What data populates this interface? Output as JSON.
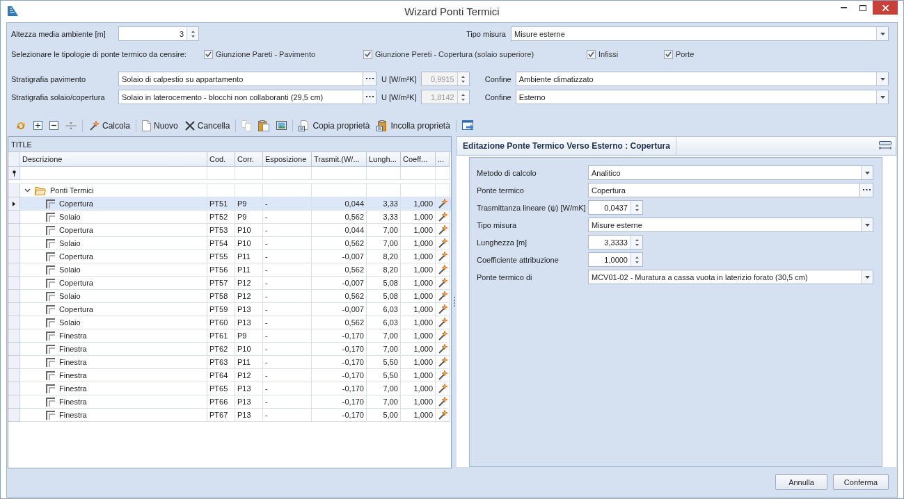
{
  "window": {
    "title": "Wizard Ponti Termici"
  },
  "form": {
    "height": {
      "label": "Altezza media ambiente [m]",
      "value": "3"
    },
    "measure": {
      "label": "Tipo misura",
      "value": "Misure esterne"
    },
    "prompt": "Selezionare le tipologie di ponte termico da censire:",
    "bridge_types": [
      {
        "label": "Giunzione Pareti - Pavimento",
        "checked": true
      },
      {
        "label": "Giunzione Pereti - Copertura (solaio superiore)",
        "checked": true
      },
      {
        "label": "Infissi",
        "checked": true
      },
      {
        "label": "Porte",
        "checked": true
      }
    ],
    "layers": [
      {
        "label": "Stratigrafia pavimento",
        "value": "Solaio di calpestio su appartamento",
        "u_label": "U [W/m²K]",
        "u_value": "0,9915",
        "u_disabled": true,
        "boundary_label": "Confine",
        "boundary_value": "Ambiente climatizzato"
      },
      {
        "label": "Stratigrafia solaio/copertura",
        "value": "Solaio in laterocemento - blocchi non collaboranti (29,5 cm)",
        "u_label": "U [W/m²K]",
        "u_value": "1,8142",
        "u_disabled": true,
        "boundary_label": "Confine",
        "boundary_value": "Esterno"
      }
    ]
  },
  "toolbar": {
    "buttons": [
      "Calcola",
      "Nuovo",
      "Cancella",
      "Copia proprietà",
      "Incolla proprietà"
    ]
  },
  "grid": {
    "title": "TITLE",
    "columns": [
      "Descrizione",
      "Cod.",
      "Corr.",
      "Esposizione",
      "Trasmit.(W/...",
      "Lungh...",
      "Coeff...",
      "..."
    ],
    "group": {
      "label": "Ponti Termici",
      "expanded": true
    },
    "rows": [
      {
        "descrizione": "Copertura",
        "cod": "PT51",
        "corr": "P9",
        "esposizione": "-",
        "trasmit": "0,044",
        "lungh": "3,33",
        "coeff": "1,000",
        "selected": true
      },
      {
        "descrizione": "Solaio",
        "cod": "PT52",
        "corr": "P9",
        "esposizione": "-",
        "trasmit": "0,562",
        "lungh": "3,33",
        "coeff": "1,000",
        "selected": false
      },
      {
        "descrizione": "Copertura",
        "cod": "PT53",
        "corr": "P10",
        "esposizione": "-",
        "trasmit": "0,044",
        "lungh": "7,00",
        "coeff": "1,000",
        "selected": false
      },
      {
        "descrizione": "Solaio",
        "cod": "PT54",
        "corr": "P10",
        "esposizione": "-",
        "trasmit": "0,562",
        "lungh": "7,00",
        "coeff": "1,000",
        "selected": false
      },
      {
        "descrizione": "Copertura",
        "cod": "PT55",
        "corr": "P11",
        "esposizione": "-",
        "trasmit": "-0,007",
        "lungh": "8,20",
        "coeff": "1,000",
        "selected": false
      },
      {
        "descrizione": "Solaio",
        "cod": "PT56",
        "corr": "P11",
        "esposizione": "-",
        "trasmit": "0,562",
        "lungh": "8,20",
        "coeff": "1,000",
        "selected": false
      },
      {
        "descrizione": "Copertura",
        "cod": "PT57",
        "corr": "P12",
        "esposizione": "-",
        "trasmit": "-0,007",
        "lungh": "5,08",
        "coeff": "1,000",
        "selected": false
      },
      {
        "descrizione": "Solaio",
        "cod": "PT58",
        "corr": "P12",
        "esposizione": "-",
        "trasmit": "0,562",
        "lungh": "5,08",
        "coeff": "1,000",
        "selected": false
      },
      {
        "descrizione": "Copertura",
        "cod": "PT59",
        "corr": "P13",
        "esposizione": "-",
        "trasmit": "-0,007",
        "lungh": "6,03",
        "coeff": "1,000",
        "selected": false
      },
      {
        "descrizione": "Solaio",
        "cod": "PT60",
        "corr": "P13",
        "esposizione": "-",
        "trasmit": "0,562",
        "lungh": "6,03",
        "coeff": "1,000",
        "selected": false
      },
      {
        "descrizione": "Finestra",
        "cod": "PT61",
        "corr": "P9",
        "esposizione": "-",
        "trasmit": "-0,170",
        "lungh": "7,00",
        "coeff": "1,000",
        "selected": false
      },
      {
        "descrizione": "Finestra",
        "cod": "PT62",
        "corr": "P10",
        "esposizione": "-",
        "trasmit": "-0,170",
        "lungh": "7,00",
        "coeff": "1,000",
        "selected": false
      },
      {
        "descrizione": "Finestra",
        "cod": "PT63",
        "corr": "P11",
        "esposizione": "-",
        "trasmit": "-0,170",
        "lungh": "5,50",
        "coeff": "1,000",
        "selected": false
      },
      {
        "descrizione": "Finestra",
        "cod": "PT64",
        "corr": "P12",
        "esposizione": "-",
        "trasmit": "-0,170",
        "lungh": "5,50",
        "coeff": "1,000",
        "selected": false
      },
      {
        "descrizione": "Finestra",
        "cod": "PT65",
        "corr": "P13",
        "esposizione": "-",
        "trasmit": "-0,170",
        "lungh": "7,00",
        "coeff": "1,000",
        "selected": false
      },
      {
        "descrizione": "Finestra",
        "cod": "PT66",
        "corr": "P13",
        "esposizione": "-",
        "trasmit": "-0,170",
        "lungh": "7,00",
        "coeff": "1,000",
        "selected": false
      },
      {
        "descrizione": "Finestra",
        "cod": "PT67",
        "corr": "P13",
        "esposizione": "-",
        "trasmit": "-0,170",
        "lungh": "5,00",
        "coeff": "1,000",
        "selected": false
      }
    ]
  },
  "editor": {
    "title": "Editazione Ponte Termico Verso Esterno : Copertura",
    "fields": [
      {
        "kind": "dropdown",
        "label": "Metodo di calcolo",
        "value": "Analitico"
      },
      {
        "kind": "browse",
        "label": "Ponte termico",
        "value": "Copertura"
      },
      {
        "kind": "spin",
        "label": "Trasmittanza lineare (ψ) [W/mK]",
        "value": "0,0437"
      },
      {
        "kind": "dropdown",
        "label": "Tipo misura",
        "value": "Misure esterne"
      },
      {
        "kind": "spin",
        "label": "Lunghezza [m]",
        "value": "3,3333"
      },
      {
        "kind": "spin",
        "label": "Coefficiente attribuzione",
        "value": "1,0000"
      },
      {
        "kind": "dropdown",
        "label": "Ponte termico di",
        "value": "MCV01-02 - Muratura a cassa vuota in laterizio forato (30,5 cm)"
      }
    ]
  },
  "footer": {
    "buttons": [
      "Annulla",
      "Conferma"
    ]
  }
}
